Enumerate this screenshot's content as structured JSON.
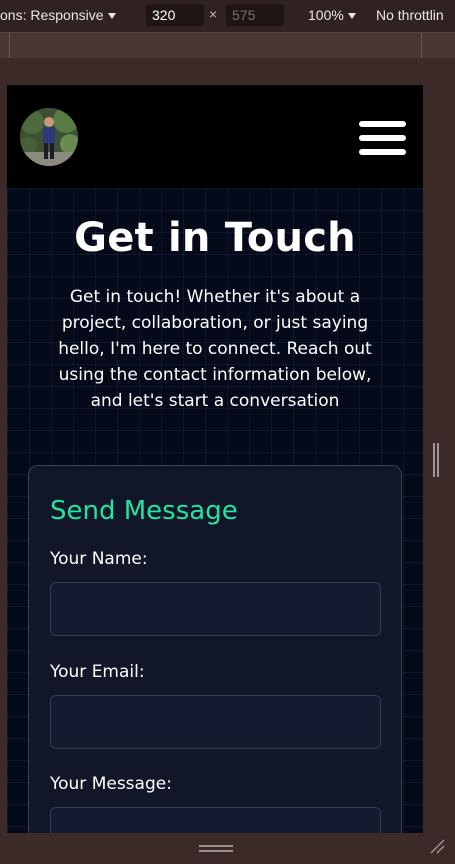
{
  "devtools": {
    "dimensions_label": "ons: Responsive",
    "width_value": "320",
    "times_symbol": "×",
    "height_value": "575",
    "zoom": "100%",
    "throttling": "No throttlin"
  },
  "navbar": {
    "avatar_alt": "profile photo",
    "menu_icon": "hamburger-menu-icon"
  },
  "hero": {
    "title": "Get in Touch",
    "intro": "Get in touch! Whether it's about a project, collaboration, or just saying hello, I'm here to connect. Reach out using the contact information below, and let's start a conversation"
  },
  "form": {
    "title": "Send Message",
    "name_label": "Your Name:",
    "name_value": "",
    "email_label": "Your Email:",
    "email_value": "",
    "message_label": "Your Message:",
    "message_value": ""
  },
  "colors": {
    "accent": "#22e3a0",
    "background": "#030712",
    "card": "#111729"
  }
}
